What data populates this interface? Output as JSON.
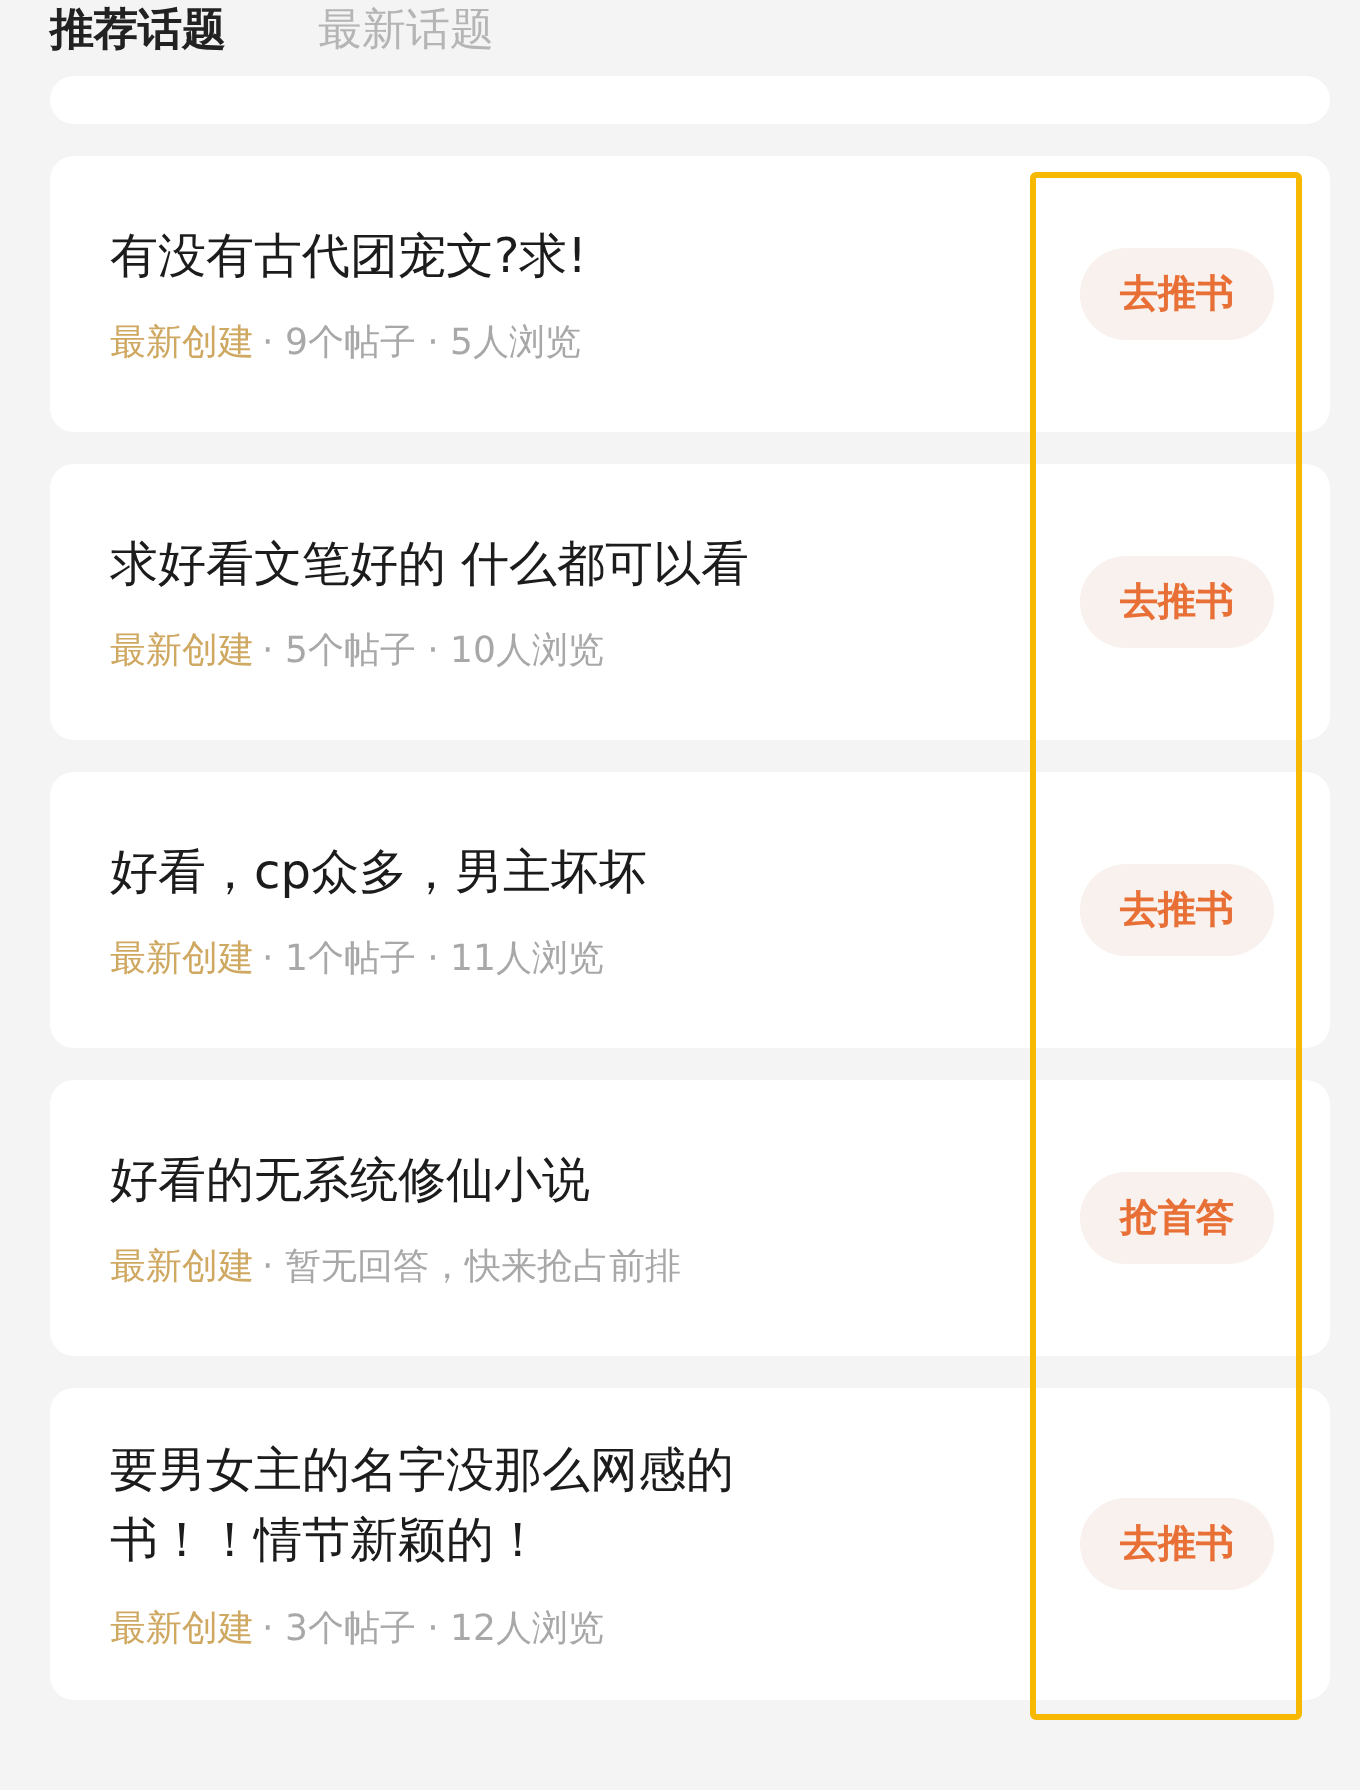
{
  "tabs": [
    {
      "label": "推荐话题",
      "selected": true
    },
    {
      "label": "最新话题",
      "selected": false
    }
  ],
  "topics": [
    {
      "title": "有没有古代团宠文?求!",
      "tag": "最新创建",
      "meta": "· 9个帖子 · 5人浏览",
      "action": "去推书"
    },
    {
      "title": "求好看文笔好的 什么都可以看",
      "tag": "最新创建",
      "meta": "· 5个帖子 · 10人浏览",
      "action": "去推书"
    },
    {
      "title": "好看，cp众多，男主坏坏",
      "tag": "最新创建",
      "meta": "· 1个帖子 · 11人浏览",
      "action": "去推书"
    },
    {
      "title": "好看的无系统修仙小说",
      "tag": "最新创建",
      "meta": "· 暂无回答，快来抢占前排",
      "action": "抢首答"
    },
    {
      "title": "要男女主的名字没那么网感的书！！情节新颖的！",
      "tag": "最新创建",
      "meta": "· 3个帖子 · 12人浏览",
      "action": "去推书"
    }
  ]
}
